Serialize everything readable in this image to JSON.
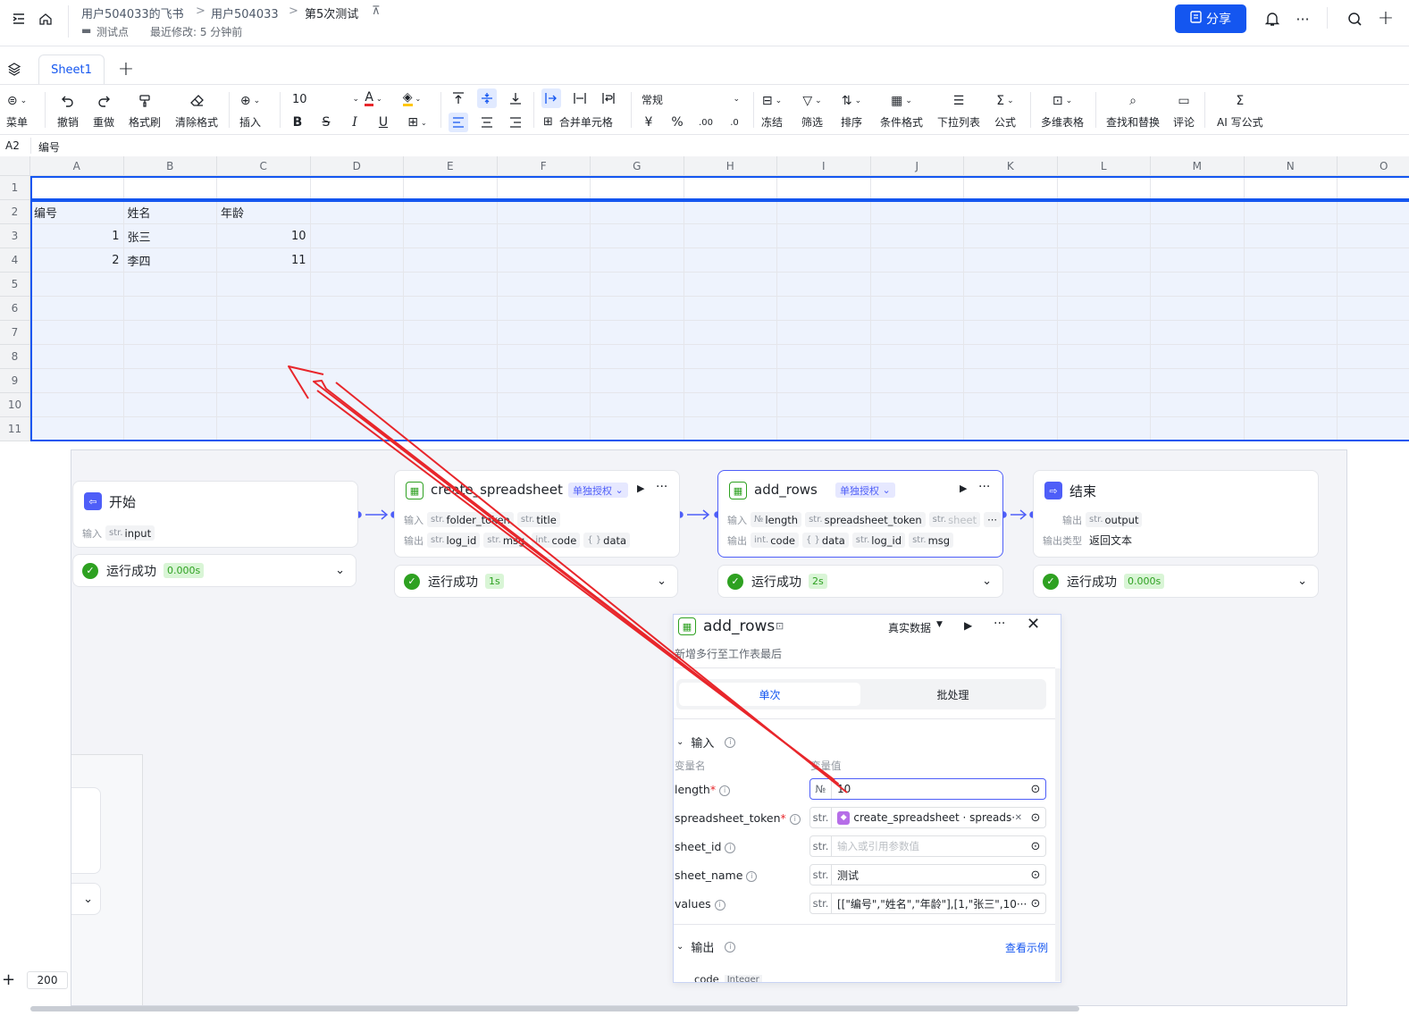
{
  "breadcrumb": {
    "c1": "用户504033的飞书",
    "c2": "用户504033",
    "current": "第5次测试",
    "sep": ">"
  },
  "doc_meta": {
    "folder": "测试点",
    "modified": "最近修改: 5 分钟前"
  },
  "header": {
    "share_label": "分享"
  },
  "tabs": {
    "sheet1": "Sheet1"
  },
  "toolbar": {
    "menu": "菜单",
    "undo": "撤销",
    "redo": "重做",
    "format_painter": "格式刷",
    "clear_format": "清除格式",
    "insert": "插入",
    "font_size": "10",
    "number_format": "常规",
    "merge": "合并单元格",
    "currency": "¥",
    "percent": "%",
    "freeze": "冻结",
    "filter": "筛选",
    "sort": "排序",
    "cond_format": "条件格式",
    "dropdown": "下拉列表",
    "formula": "公式",
    "multi_table": "多维表格",
    "find_replace": "查找和替换",
    "comment": "评论",
    "ai_formula": "AI 写公式"
  },
  "formula_bar": {
    "cell_ref": "A2",
    "content": "编号"
  },
  "grid": {
    "columns": [
      "A",
      "B",
      "C",
      "D",
      "E",
      "F",
      "G",
      "H",
      "I",
      "J",
      "K",
      "L",
      "M",
      "N",
      "O"
    ],
    "rows": [
      "1",
      "2",
      "3",
      "4",
      "5",
      "6",
      "7",
      "8",
      "9",
      "10",
      "11"
    ],
    "data": {
      "r2": [
        "编号",
        "姓名",
        "年龄"
      ],
      "r3": [
        "1",
        "张三",
        "10"
      ],
      "r4": [
        "2",
        "李四",
        "11"
      ]
    }
  },
  "zoom": "200",
  "workflow": {
    "start": {
      "title": "开始",
      "in_label": "输入",
      "in_var": "input"
    },
    "create": {
      "title": "create_spreadsheet",
      "auth": "单独授权",
      "in_label": "输入",
      "out_label": "输出",
      "inputs": [
        "folder_token",
        "title"
      ],
      "outputs": [
        "log_id",
        "msg",
        "code",
        "data"
      ]
    },
    "add": {
      "title": "add_rows",
      "auth": "单独授权",
      "in_label": "输入",
      "out_label": "输出",
      "inputs": [
        "length",
        "spreadsheet_token",
        "sheet"
      ],
      "outputs": [
        "code",
        "data",
        "log_id",
        "msg"
      ]
    },
    "end": {
      "title": "结束",
      "out_label": "输出",
      "out_var": "output",
      "type_label": "输出类型",
      "type_val": "返回文本"
    },
    "runs": {
      "label": "运行成功",
      "t1": "0.000s",
      "t2": "1s",
      "t3": "2s",
      "t4": "0.000s"
    }
  },
  "panel": {
    "title": "add_rows",
    "data_mode": "真实数据",
    "desc": "新增多行至工作表最后",
    "tab_single": "单次",
    "tab_batch": "批处理",
    "input_section": "输入",
    "col_name": "变量名",
    "col_value": "变量值",
    "fields": [
      {
        "name": "length",
        "type": "№",
        "value": "10"
      },
      {
        "name": "spreadsheet_token",
        "type": "str.",
        "value": "create_spreadsheet · spreads···"
      },
      {
        "name": "sheet_id",
        "type": "str.",
        "placeholder": "输入或引用参数值"
      },
      {
        "name": "sheet_name",
        "type": "str.",
        "value": "测试"
      },
      {
        "name": "values",
        "type": "str.",
        "value": "[[\"编号\",\"姓名\",\"年龄\"],[1,\"张三\",10···"
      }
    ],
    "output_section": "输出",
    "view_example": "查看示例",
    "out_var": "code",
    "out_type": "Integer"
  },
  "colors": {
    "accent": "#1456f0",
    "success": "#2ea121",
    "flow": "#4e5ef8",
    "arrow": "#e8262b"
  }
}
